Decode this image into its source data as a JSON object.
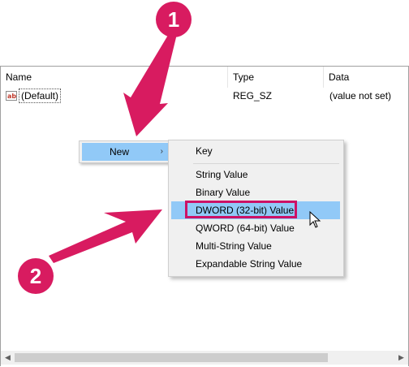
{
  "columns": {
    "name": "Name",
    "type": "Type",
    "data": "Data"
  },
  "rows": [
    {
      "icon": "ab",
      "name": "(Default)",
      "type": "REG_SZ",
      "data": "(value not set)"
    }
  ],
  "context_menu": {
    "item": "New",
    "arrow": "›"
  },
  "submenu": {
    "items": [
      "Key",
      "String Value",
      "Binary Value",
      "DWORD (32-bit) Value",
      "QWORD (64-bit) Value",
      "Multi-String Value",
      "Expandable String Value"
    ],
    "highlighted": "DWORD (32-bit) Value"
  },
  "callouts": {
    "step1": "1",
    "step2": "2",
    "color": "#d81b60"
  },
  "scrollbar": {
    "left_arrow": "◀",
    "right_arrow": "▶"
  },
  "colors": {
    "menu_hover": "#91c9f7",
    "highlight_border": "#cc1166"
  }
}
